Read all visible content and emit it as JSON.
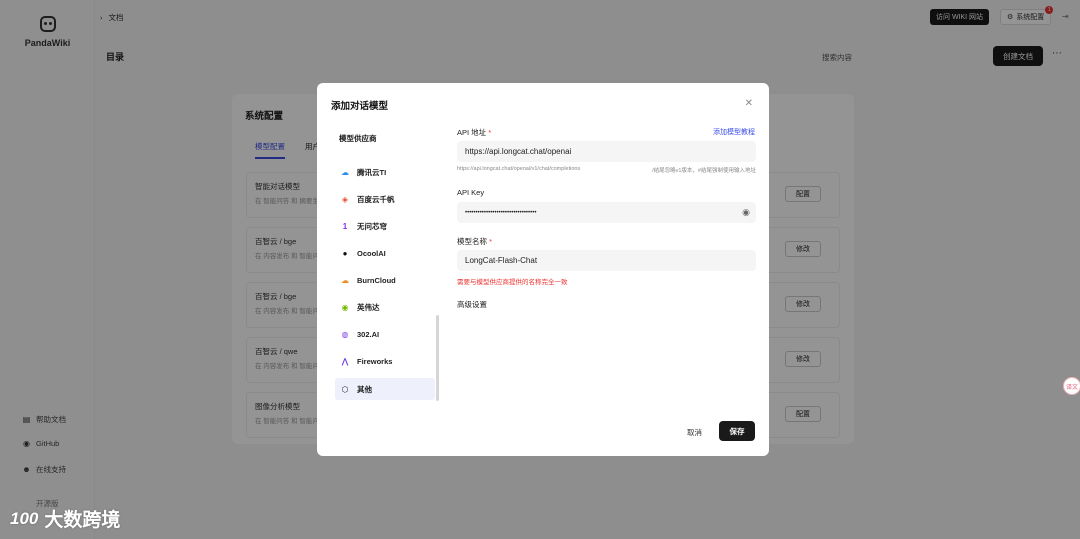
{
  "sidebar": {
    "logo_text": "PandaWiki",
    "links": [
      {
        "icon": "document-icon",
        "label": "帮助文档"
      },
      {
        "icon": "github-icon",
        "label": "GitHub"
      },
      {
        "icon": "support-icon",
        "label": "在线支持"
      }
    ],
    "footer_text": "开源版"
  },
  "topbar": {
    "breadcrumb": "文档",
    "visit_wiki_label": "访问 WIKI 网站",
    "settings_label": "系统配置",
    "settings_badge": "1"
  },
  "main": {
    "toc_title": "目录",
    "search_label": "搜索内容",
    "create_doc_label": "创建文档"
  },
  "system_config": {
    "title": "系统配置",
    "tabs": [
      "模型配置",
      "用户"
    ],
    "rows": [
      {
        "title": "智能对话模型",
        "sub": "在 智能问答 和 摘要生",
        "button": "配置"
      },
      {
        "title": "百智云 / bge",
        "sub": "在 内容发布 和 智能问",
        "button": "修改"
      },
      {
        "title": "百智云 / bge",
        "sub": "在 内容发布 和 智能问",
        "button": "修改"
      },
      {
        "title": "百智云 / qwe",
        "sub": "在 内容发布 和 智能问",
        "button": "修改"
      },
      {
        "title": "图像分析模型",
        "sub": "在 智能问答 和 智能问",
        "button": "配置"
      }
    ]
  },
  "modal": {
    "title": "添加对话模型",
    "provider_heading": "模型供应商",
    "providers": [
      {
        "name": "腾讯云TI",
        "icon": "cloud-icon",
        "color": "#2d8cf0"
      },
      {
        "name": "百度云千帆",
        "icon": "qianfan-icon",
        "color": "#e84a2f"
      },
      {
        "name": "无问芯穹",
        "icon": "infini-icon",
        "color": "#8a2be2"
      },
      {
        "name": "OcoolAI",
        "icon": "ocoolai-icon",
        "color": "#111111"
      },
      {
        "name": "BurnCloud",
        "icon": "burncloud-icon",
        "color": "#f08a24"
      },
      {
        "name": "英伟达",
        "icon": "nvidia-icon",
        "color": "#76b900"
      },
      {
        "name": "302.AI",
        "icon": "ai302-icon",
        "color": "#7b3fe4"
      },
      {
        "name": "Fireworks",
        "icon": "fireworks-icon",
        "color": "#6a3de8"
      },
      {
        "name": "其他",
        "icon": "cube-icon",
        "color": "#222222"
      }
    ],
    "api_url_label": "API 地址",
    "tutorial_link": "添加模型教程",
    "api_url_value": "https://api.longcat.chat/openai",
    "api_url_hint": "https://api.longcat.chat/openai/v1/chat/completions",
    "api_url_hint_right": "/结尾忽略v1版本，#结尾强制使用输入地址",
    "api_key_label": "API Key",
    "api_key_value": "••••••••••••••••••••••••••••••••••",
    "model_name_label": "模型名称",
    "model_name_value": "LongCat-Flash-Chat",
    "model_name_error": "需要与模型供应商提供的名称完全一致",
    "advanced_label": "高级设置",
    "cancel_label": "取消",
    "save_label": "保存"
  },
  "watermark": {
    "logo": "100",
    "text": "大数跨境"
  },
  "float_button": "译文"
}
